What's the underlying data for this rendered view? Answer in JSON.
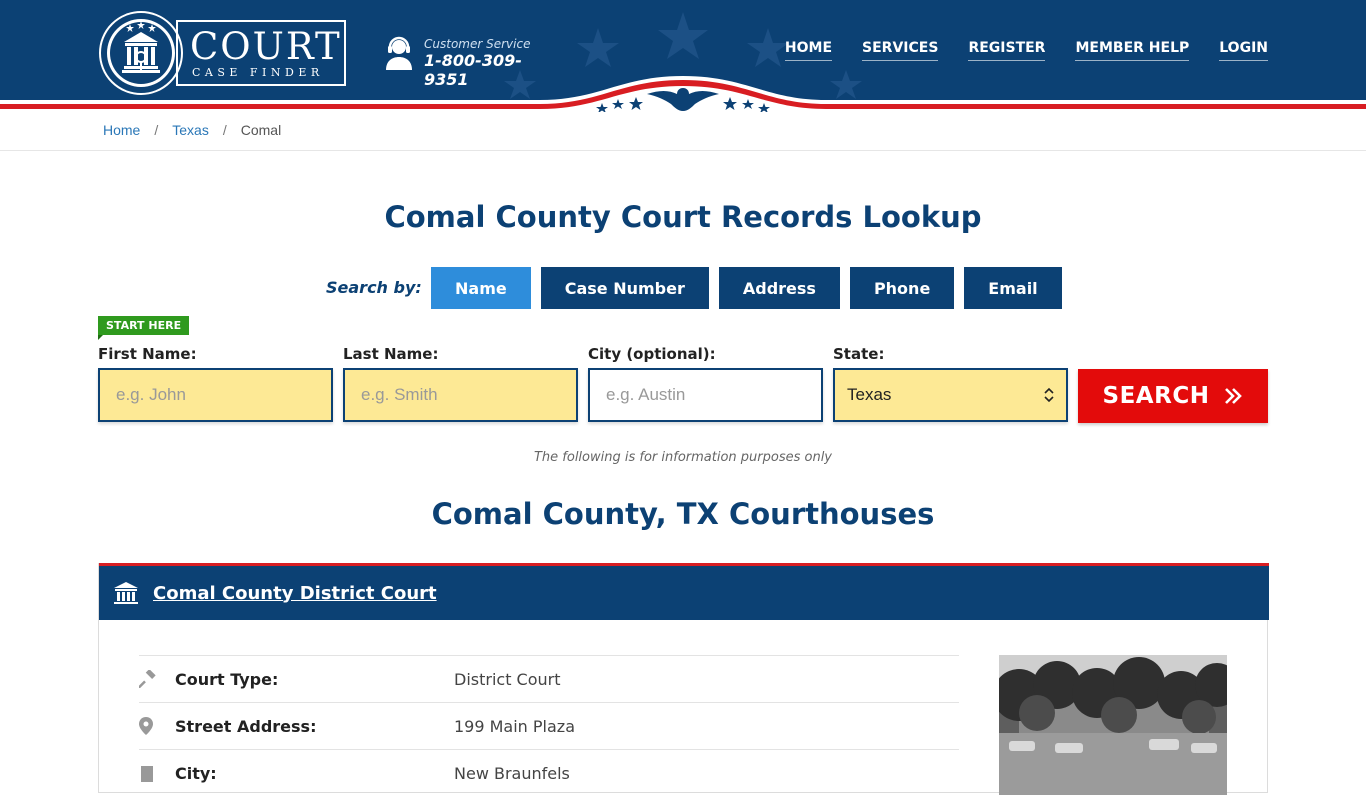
{
  "header": {
    "logo_main": "COURT",
    "logo_sub": "CASE FINDER",
    "customer_service_label": "Customer Service",
    "phone": "1-800-309-9351",
    "nav": [
      "HOME",
      "SERVICES",
      "REGISTER",
      "MEMBER HELP",
      "LOGIN"
    ]
  },
  "breadcrumb": {
    "items": [
      "Home",
      "Texas",
      "Comal"
    ],
    "separator": "/"
  },
  "page_title": "Comal County Court Records Lookup",
  "search": {
    "search_by_label": "Search by:",
    "tabs": [
      "Name",
      "Case Number",
      "Address",
      "Phone",
      "Email"
    ],
    "active_tab": "Name",
    "start_here": "START HERE",
    "fields": {
      "first_name": {
        "label": "First Name:",
        "placeholder": "e.g. John"
      },
      "last_name": {
        "label": "Last Name:",
        "placeholder": "e.g. Smith"
      },
      "city": {
        "label": "City (optional):",
        "placeholder": "e.g.  Austin"
      },
      "state": {
        "label": "State:",
        "value": "Texas"
      }
    },
    "button_label": "SEARCH",
    "note": "The following is for information purposes only"
  },
  "section_title": "Comal County, TX Courthouses",
  "court": {
    "name": "Comal County District Court",
    "rows": [
      {
        "icon": "gavel-icon",
        "key": "Court Type:",
        "value": "District Court"
      },
      {
        "icon": "map-pin-icon",
        "key": "Street Address:",
        "value": "199 Main Plaza"
      },
      {
        "icon": "building-icon",
        "key": "City:",
        "value": "New Braunfels"
      }
    ]
  },
  "colors": {
    "navy": "#0c4174",
    "active_tab": "#2e8ddb",
    "search_red": "#e30b0b",
    "input_yellow": "#fde995",
    "start_green": "#2f9a1e",
    "stripe_red": "#d81d22"
  }
}
